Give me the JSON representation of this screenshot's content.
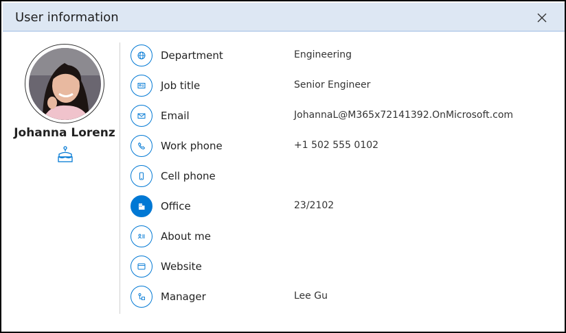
{
  "dialog": {
    "title": "User information",
    "close_icon": "close-icon"
  },
  "profile": {
    "name": "Johanna Lorenz",
    "avatar_icon": "avatar",
    "birthday_icon": "birthday-cake-icon"
  },
  "colors": {
    "accent": "#0078d4",
    "header_bg": "#dde7f3"
  },
  "rows": [
    {
      "label": "Department",
      "value": "Engineering",
      "icon": "globe-icon"
    },
    {
      "label": "Job title",
      "value": "Senior Engineer",
      "icon": "id-card-icon"
    },
    {
      "label": "Email",
      "value": "JohannaL@M365x72141392.OnMicrosoft.com",
      "icon": "mail-icon"
    },
    {
      "label": "Work phone",
      "value": "+1 502 555 0102",
      "icon": "phone-icon"
    },
    {
      "label": "Cell phone",
      "value": "",
      "icon": "mobile-icon"
    },
    {
      "label": "Office",
      "value": "23/2102",
      "icon": "building-icon"
    },
    {
      "label": "About me",
      "value": "",
      "icon": "contact-card-icon"
    },
    {
      "label": "Website",
      "value": "",
      "icon": "browser-icon"
    },
    {
      "label": "Manager",
      "value": "Lee Gu",
      "icon": "org-icon"
    }
  ]
}
